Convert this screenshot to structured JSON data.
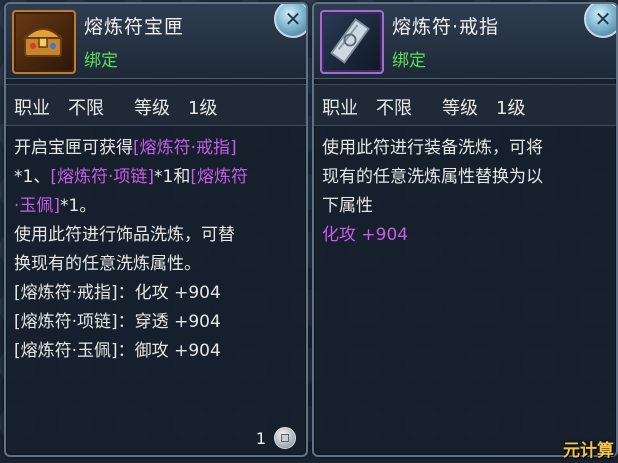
{
  "left_panel": {
    "title": "熔炼符宝匣",
    "bind_status": "绑定",
    "profession_label": "职业",
    "profession_value": "不限",
    "level_label": "等级",
    "level_value": "1级",
    "desc_lines": [
      {
        "parts": [
          {
            "text": "开启宝匣可获得",
            "c": "w"
          },
          {
            "text": "[熔炼符·戒指]",
            "c": "p"
          }
        ]
      },
      {
        "parts": [
          {
            "text": "*1、",
            "c": "w"
          },
          {
            "text": "[熔炼符·项链]",
            "c": "p"
          },
          {
            "text": "*1和",
            "c": "w"
          },
          {
            "text": "[熔炼符",
            "c": "p"
          }
        ]
      },
      {
        "parts": [
          {
            "text": "·玉佩]",
            "c": "p"
          },
          {
            "text": "*1。",
            "c": "w"
          }
        ]
      },
      {
        "parts": [
          {
            "text": "使用此符进行饰品洗炼，可替",
            "c": "w"
          }
        ]
      },
      {
        "parts": [
          {
            "text": "换现有的任意洗炼属性。",
            "c": "w"
          }
        ]
      },
      {
        "parts": [
          {
            "text": "[熔炼符·戒指]：化攻 +904",
            "c": "w"
          }
        ]
      },
      {
        "parts": [
          {
            "text": "[熔炼符·项链]：穿透 +904",
            "c": "w"
          }
        ]
      },
      {
        "parts": [
          {
            "text": "[熔炼符·玉佩]：御攻 +904",
            "c": "w"
          }
        ]
      }
    ],
    "count": "1"
  },
  "right_panel": {
    "title": "熔炼符·戒指",
    "bind_status": "绑定",
    "profession_label": "职业",
    "profession_value": "不限",
    "level_label": "等级",
    "level_value": "1级",
    "desc_lines": [
      {
        "parts": [
          {
            "text": "使用此符进行装备洗炼，可将",
            "c": "w"
          }
        ]
      },
      {
        "parts": [
          {
            "text": "现有的任意洗炼属性替换为以",
            "c": "w"
          }
        ]
      },
      {
        "parts": [
          {
            "text": "下属性",
            "c": "w"
          }
        ]
      },
      {
        "parts": [
          {
            "text": "化攻 +904",
            "c": "p"
          }
        ]
      }
    ]
  },
  "close_glyph": "✕",
  "watermark": "元计算",
  "colors": {
    "bind_green": "#58e058",
    "highlight_purple": "#c65ce8",
    "chest_border": "#c07a2a",
    "talisman_border": "#a46ad8"
  },
  "icons": {
    "left_item": "treasure-chest-icon",
    "right_item": "talisman-scroll-icon",
    "currency": "coin-icon"
  }
}
